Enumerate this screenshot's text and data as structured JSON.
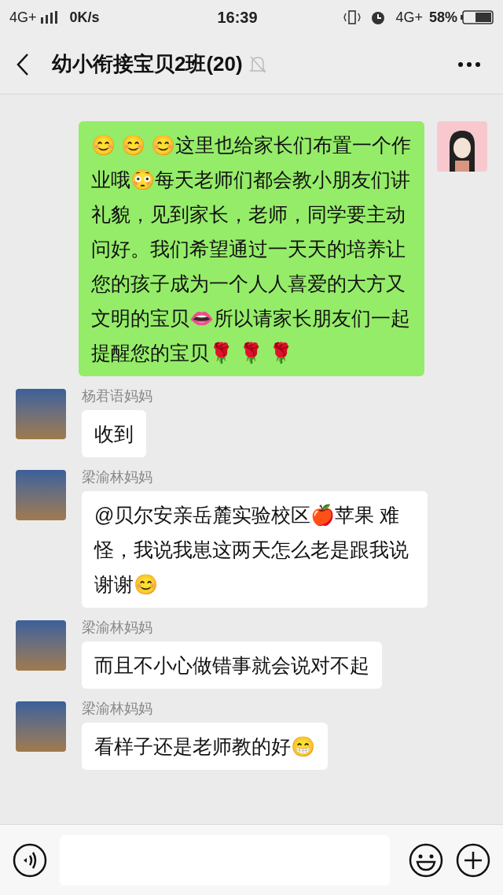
{
  "status_bar": {
    "network": "4G+",
    "speed": "0K/s",
    "time": "16:39",
    "network_right": "4G+",
    "battery": "58%"
  },
  "header": {
    "title": "幼小衔接宝贝2班(20)",
    "muted": true
  },
  "messages": [
    {
      "kind": "sent",
      "text": "😊 😊 😊这里也给家长们布置一个作业哦😳每天老师们都会教小朋友们讲礼貌，见到家长，老师，同学要主动问好。我们希望通过一天天的培养让您的孩子成为一个人人喜爱的大方又文明的宝贝👄所以请家长朋友们一起提醒您的宝贝🌹 🌹 🌹"
    },
    {
      "kind": "received",
      "sender": "杨君语妈妈",
      "text": "收到"
    },
    {
      "kind": "received",
      "sender": "梁渝林妈妈",
      "text": "@贝尔安亲岳麓实验校区🍎苹果 难怪，我说我崽这两天怎么老是跟我说谢谢😊"
    },
    {
      "kind": "received",
      "sender": "梁渝林妈妈",
      "text": "而且不小心做错事就会说对不起"
    },
    {
      "kind": "received",
      "sender": "梁渝林妈妈",
      "text": "看样子还是老师教的好😁"
    }
  ]
}
